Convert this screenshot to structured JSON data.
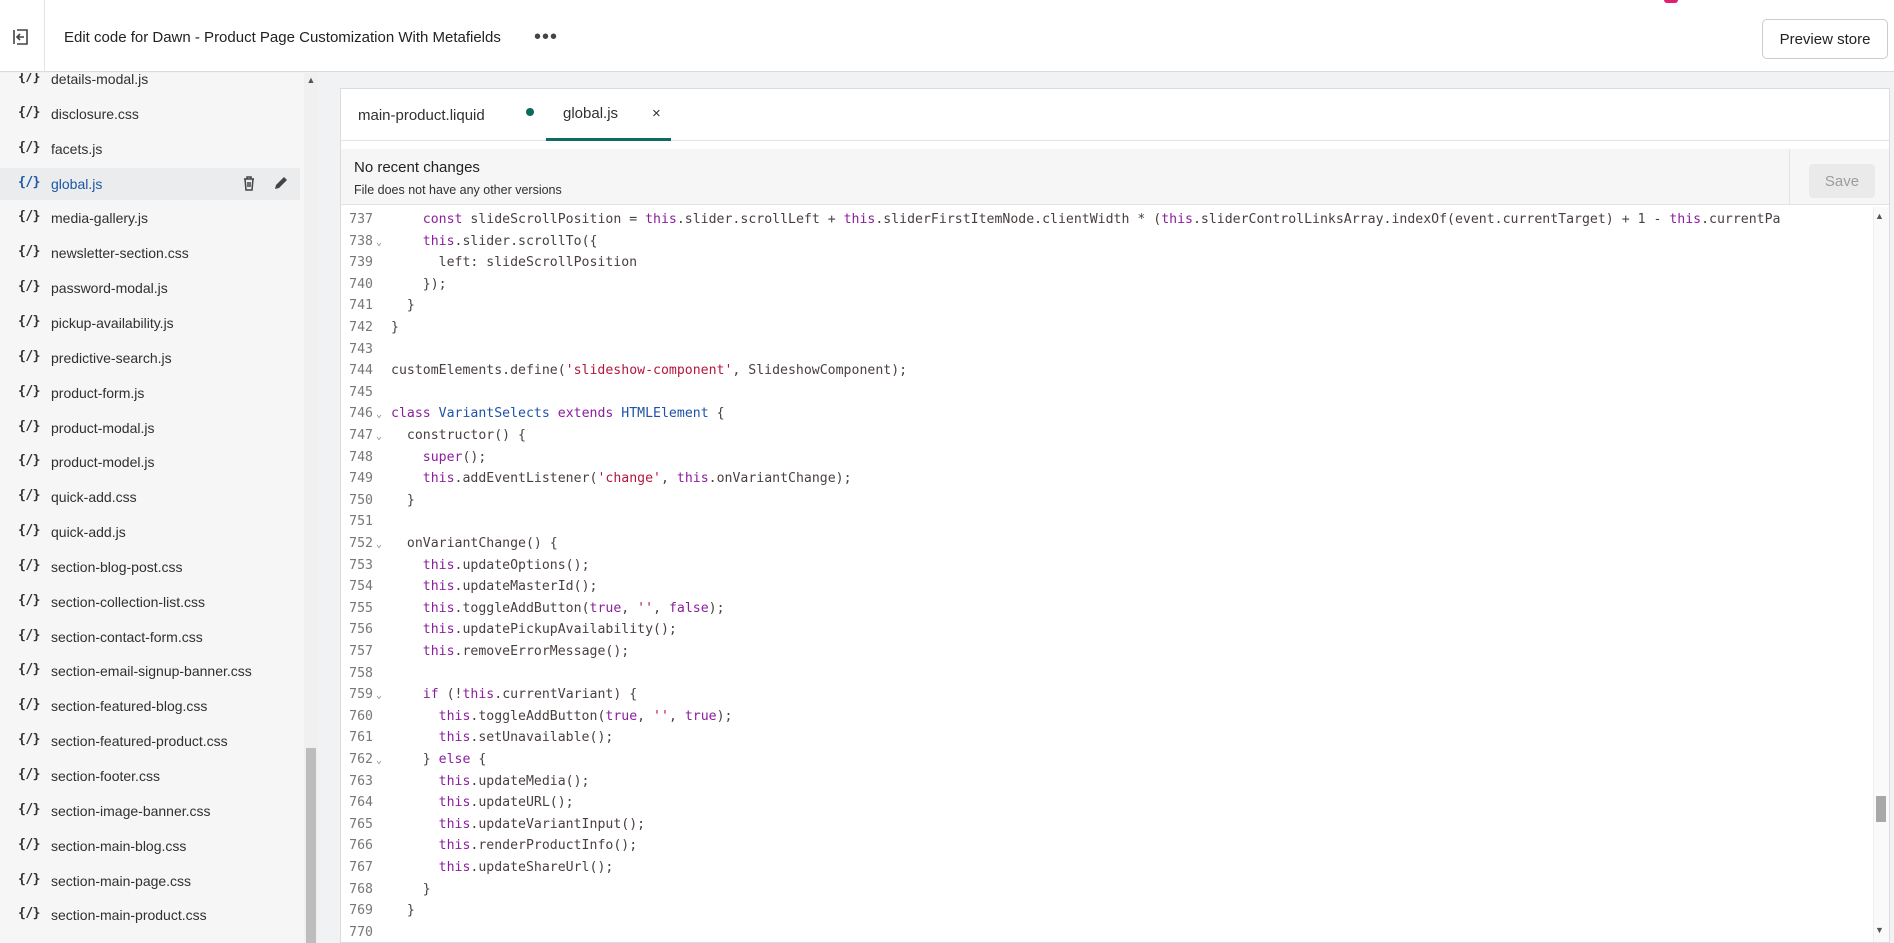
{
  "header": {
    "title": "Edit code for Dawn - Product Page Customization With Metafields",
    "more_label": "•••",
    "preview_label": "Preview store"
  },
  "sidebar": {
    "files": [
      {
        "icon": "{/}",
        "name": "details-modal.js"
      },
      {
        "icon": "{/}",
        "name": "disclosure.css"
      },
      {
        "icon": "{/}",
        "name": "facets.js"
      },
      {
        "icon": "{/}",
        "name": "global.js",
        "active": true
      },
      {
        "icon": "{/}",
        "name": "media-gallery.js"
      },
      {
        "icon": "{/}",
        "name": "newsletter-section.css"
      },
      {
        "icon": "{/}",
        "name": "password-modal.js"
      },
      {
        "icon": "{/}",
        "name": "pickup-availability.js"
      },
      {
        "icon": "{/}",
        "name": "predictive-search.js"
      },
      {
        "icon": "{/}",
        "name": "product-form.js"
      },
      {
        "icon": "{/}",
        "name": "product-modal.js"
      },
      {
        "icon": "{/}",
        "name": "product-model.js"
      },
      {
        "icon": "{/}",
        "name": "quick-add.css"
      },
      {
        "icon": "{/}",
        "name": "quick-add.js"
      },
      {
        "icon": "{/}",
        "name": "section-blog-post.css"
      },
      {
        "icon": "{/}",
        "name": "section-collection-list.css"
      },
      {
        "icon": "{/}",
        "name": "section-contact-form.css"
      },
      {
        "icon": "{/}",
        "name": "section-email-signup-banner.css"
      },
      {
        "icon": "{/}",
        "name": "section-featured-blog.css"
      },
      {
        "icon": "{/}",
        "name": "section-featured-product.css"
      },
      {
        "icon": "{/}",
        "name": "section-footer.css"
      },
      {
        "icon": "{/}",
        "name": "section-image-banner.css"
      },
      {
        "icon": "{/}",
        "name": "section-main-blog.css"
      },
      {
        "icon": "{/}",
        "name": "section-main-page.css"
      },
      {
        "icon": "{/}",
        "name": "section-main-product.css"
      }
    ]
  },
  "tabs": [
    {
      "label": "main-product.liquid",
      "unsaved": true
    },
    {
      "label": "global.js",
      "active": true,
      "close": "×"
    }
  ],
  "changes": {
    "heading": "No recent changes",
    "subtext": "File does not have any other versions",
    "save_label": "Save"
  },
  "code": {
    "lines": [
      {
        "n": "737",
        "fold": false,
        "text": "    const slideScrollPosition = this.slider.scrollLeft + this.sliderFirstItemNode.clientWidth * (this.sliderControlLinksArray.indexOf(event.currentTarget) + 1 - this.currentPa"
      },
      {
        "n": "738",
        "fold": true,
        "text": "    this.slider.scrollTo({"
      },
      {
        "n": "739",
        "fold": false,
        "text": "      left: slideScrollPosition"
      },
      {
        "n": "740",
        "fold": false,
        "text": "    });"
      },
      {
        "n": "741",
        "fold": false,
        "text": "  }"
      },
      {
        "n": "742",
        "fold": false,
        "text": "}"
      },
      {
        "n": "743",
        "fold": false,
        "text": ""
      },
      {
        "n": "744",
        "fold": false,
        "text": "customElements.define('slideshow-component', SlideshowComponent);"
      },
      {
        "n": "745",
        "fold": false,
        "text": ""
      },
      {
        "n": "746",
        "fold": true,
        "text": "class VariantSelects extends HTMLElement {"
      },
      {
        "n": "747",
        "fold": true,
        "text": "  constructor() {"
      },
      {
        "n": "748",
        "fold": false,
        "text": "    super();"
      },
      {
        "n": "749",
        "fold": false,
        "text": "    this.addEventListener('change', this.onVariantChange);"
      },
      {
        "n": "750",
        "fold": false,
        "text": "  }"
      },
      {
        "n": "751",
        "fold": false,
        "text": ""
      },
      {
        "n": "752",
        "fold": true,
        "text": "  onVariantChange() {"
      },
      {
        "n": "753",
        "fold": false,
        "text": "    this.updateOptions();"
      },
      {
        "n": "754",
        "fold": false,
        "text": "    this.updateMasterId();"
      },
      {
        "n": "755",
        "fold": false,
        "text": "    this.toggleAddButton(true, '', false);"
      },
      {
        "n": "756",
        "fold": false,
        "text": "    this.updatePickupAvailability();"
      },
      {
        "n": "757",
        "fold": false,
        "text": "    this.removeErrorMessage();"
      },
      {
        "n": "758",
        "fold": false,
        "text": ""
      },
      {
        "n": "759",
        "fold": true,
        "text": "    if (!this.currentVariant) {"
      },
      {
        "n": "760",
        "fold": false,
        "text": "      this.toggleAddButton(true, '', true);"
      },
      {
        "n": "761",
        "fold": false,
        "text": "      this.setUnavailable();"
      },
      {
        "n": "762",
        "fold": true,
        "text": "    } else {"
      },
      {
        "n": "763",
        "fold": false,
        "text": "      this.updateMedia();"
      },
      {
        "n": "764",
        "fold": false,
        "text": "      this.updateURL();"
      },
      {
        "n": "765",
        "fold": false,
        "text": "      this.updateVariantInput();"
      },
      {
        "n": "766",
        "fold": false,
        "text": "      this.renderProductInfo();"
      },
      {
        "n": "767",
        "fold": false,
        "text": "      this.updateShareUrl();"
      },
      {
        "n": "768",
        "fold": false,
        "text": "    }"
      },
      {
        "n": "769",
        "fold": false,
        "text": "  }"
      },
      {
        "n": "770",
        "fold": false,
        "text": ""
      }
    ]
  },
  "colors": {
    "keyword": "#8a1f9c",
    "string": "#b5173b",
    "class_name": "#1f52a6",
    "default_text": "#4a3f3f",
    "active_file": "#1c56a4",
    "tab_underline": "#0e6b60"
  }
}
